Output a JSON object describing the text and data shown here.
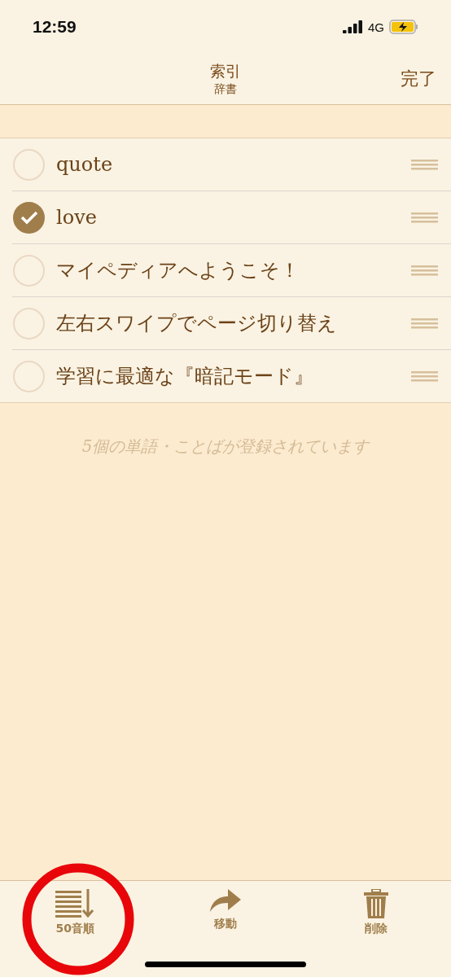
{
  "status_bar": {
    "time": "12:59",
    "network": "4G"
  },
  "nav": {
    "title": "索引",
    "subtitle": "辞書",
    "done": "完了"
  },
  "items": [
    {
      "label": "quote",
      "checked": false
    },
    {
      "label": "love",
      "checked": true
    },
    {
      "label": "マイペディアへようこそ！",
      "checked": false
    },
    {
      "label": "左右スワイプでページ切り替え",
      "checked": false
    },
    {
      "label": "学習に最適な『暗記モード』",
      "checked": false
    }
  ],
  "footer_note": "5個の単語・ことばが登録されています",
  "toolbar": [
    {
      "kind": "sort",
      "label": "50音順"
    },
    {
      "kind": "move",
      "label": "移動"
    },
    {
      "kind": "delete",
      "label": "削除"
    }
  ]
}
